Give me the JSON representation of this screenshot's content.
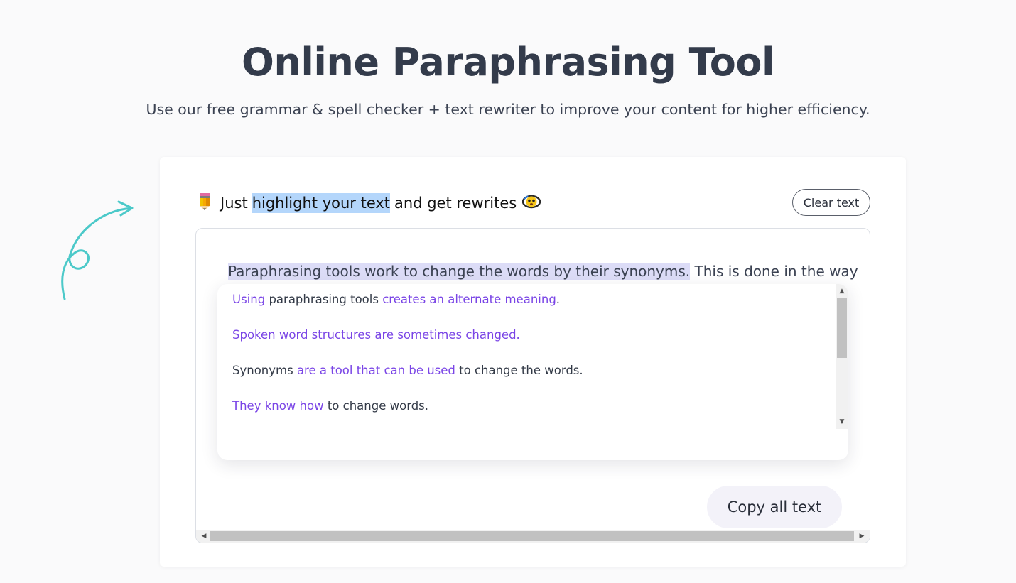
{
  "header": {
    "title": "Online Paraphrasing Tool",
    "subtitle": "Use our free grammar & spell checker + text rewriter to improve your content for higher efficiency."
  },
  "tool": {
    "hint": {
      "icon": "pencil-emoji",
      "prefix": "Just",
      "highlight": "highlight your text",
      "suffix": "and get rewrites",
      "end_icon": "dizzy-face-emoji"
    },
    "clear_label": "Clear text",
    "editor": {
      "selected_text": "Paraphrasing tools work to change the words by their synonyms.",
      "rest_text": " This is done in the way"
    },
    "suggestions": [
      [
        {
          "text": "Using",
          "changed": true
        },
        {
          "text": " paraphrasing tools ",
          "changed": false
        },
        {
          "text": "creates an alternate meaning",
          "changed": true
        },
        {
          "text": ".",
          "changed": false
        }
      ],
      [
        {
          "text": "Spoken word structures are sometimes changed.",
          "changed": true
        }
      ],
      [
        {
          "text": "Synonyms ",
          "changed": false
        },
        {
          "text": "are a tool that can be used",
          "changed": true
        },
        {
          "text": " to change the words.",
          "changed": false
        }
      ],
      [
        {
          "text": "They know how",
          "changed": true
        },
        {
          "text": " to change words.",
          "changed": false
        }
      ]
    ],
    "copy_label": "Copy all text"
  },
  "colors": {
    "highlight": "#b4d6fb",
    "selection": "#dcdcf7",
    "changed_text": "#7a45e6",
    "decorative_arrow": "#4cc9c9"
  }
}
